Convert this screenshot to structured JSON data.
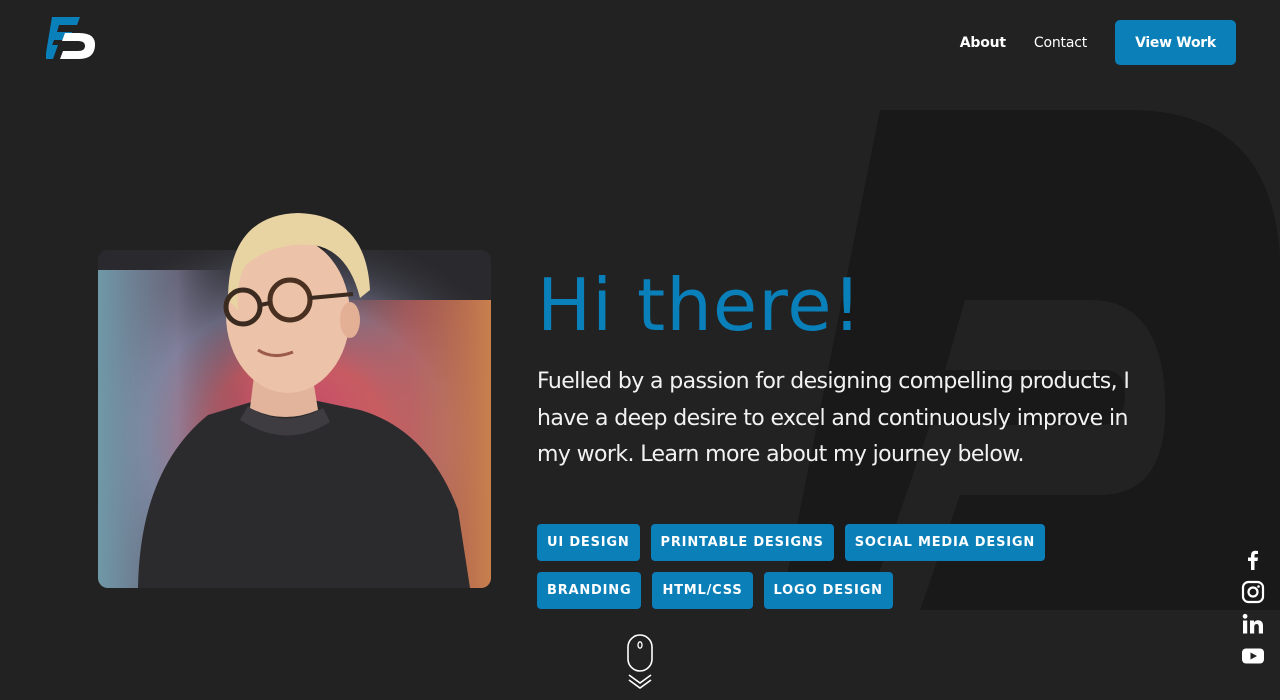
{
  "header": {
    "logo_name": "fp-logo",
    "nav": {
      "about_label": "About",
      "contact_label": "Contact",
      "cta_label": "View Work"
    }
  },
  "hero": {
    "title": "Hi there!",
    "body": "Fuelled by a passion for designing compelling products, I have a deep desire to excel and continuously improve in my work. Learn more about my journey below.",
    "tags_row1": [
      "UI DESIGN",
      "PRINTABLE DESIGNS",
      "SOCIAL MEDIA DESIGN"
    ],
    "tags_row2": [
      "BRANDING",
      "HTML/CSS",
      "LOGO DESIGN"
    ]
  },
  "scroll_indicator": {
    "icon": "mouse-scroll-icon"
  },
  "social": [
    {
      "icon": "facebook-icon"
    },
    {
      "icon": "instagram-icon"
    },
    {
      "icon": "linkedin-icon"
    },
    {
      "icon": "youtube-icon"
    }
  ],
  "colors": {
    "background": "#222223",
    "accent": "#0a7fb8",
    "title": "#0a80bb",
    "text": "#f2f2f2",
    "watermark": "#1a1a1b"
  }
}
